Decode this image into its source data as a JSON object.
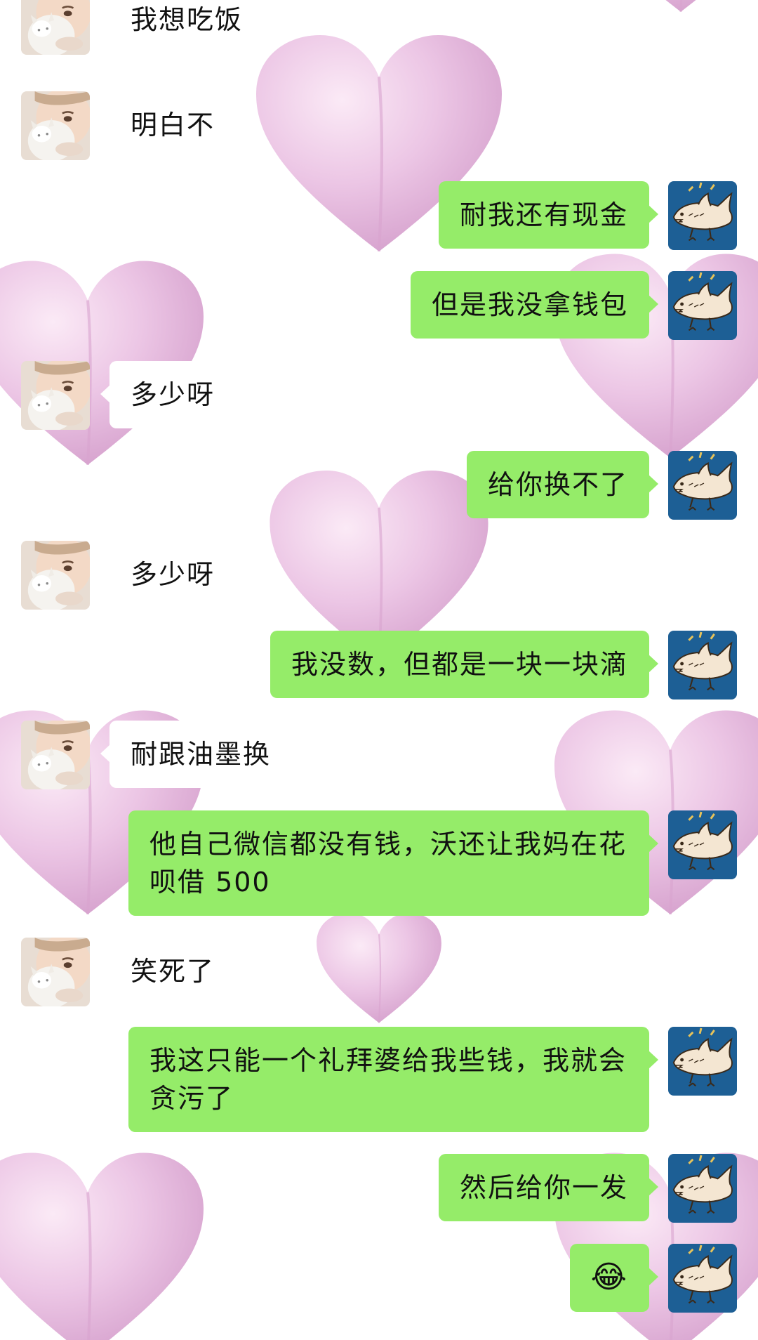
{
  "chat": {
    "messages": [
      {
        "sender": "other",
        "text": "我想吃饭"
      },
      {
        "sender": "other",
        "text": "明白不"
      },
      {
        "sender": "self",
        "text": "耐我还有现金"
      },
      {
        "sender": "self",
        "text": "但是我没拿钱包"
      },
      {
        "sender": "other",
        "text": "多少呀"
      },
      {
        "sender": "self",
        "text": "给你换不了"
      },
      {
        "sender": "other",
        "text": "多少呀"
      },
      {
        "sender": "self",
        "text": "我没数，但都是一块一块滴"
      },
      {
        "sender": "other",
        "text": "耐跟油墨换"
      },
      {
        "sender": "self",
        "text": "他自己微信都没有钱，沃还让我妈在花呗借 500"
      },
      {
        "sender": "other",
        "text": "笑死了"
      },
      {
        "sender": "self",
        "text": "我这只能一个礼拜婆给我些钱，我就会贪污了"
      },
      {
        "sender": "self",
        "text": "然后给你一发"
      },
      {
        "sender": "self",
        "text": "😂",
        "icon": "tears-of-joy-emoji-icon"
      }
    ]
  },
  "theme": {
    "self_bubble_color": "#95ec69",
    "other_bubble_color": "#ffffff",
    "background_color": "#ffffff",
    "heart_color": "#e8bde0",
    "self_avatar_icon": "shark-drawing-avatar-icon",
    "other_avatar_icon": "girl-with-cat-avatar-icon"
  }
}
